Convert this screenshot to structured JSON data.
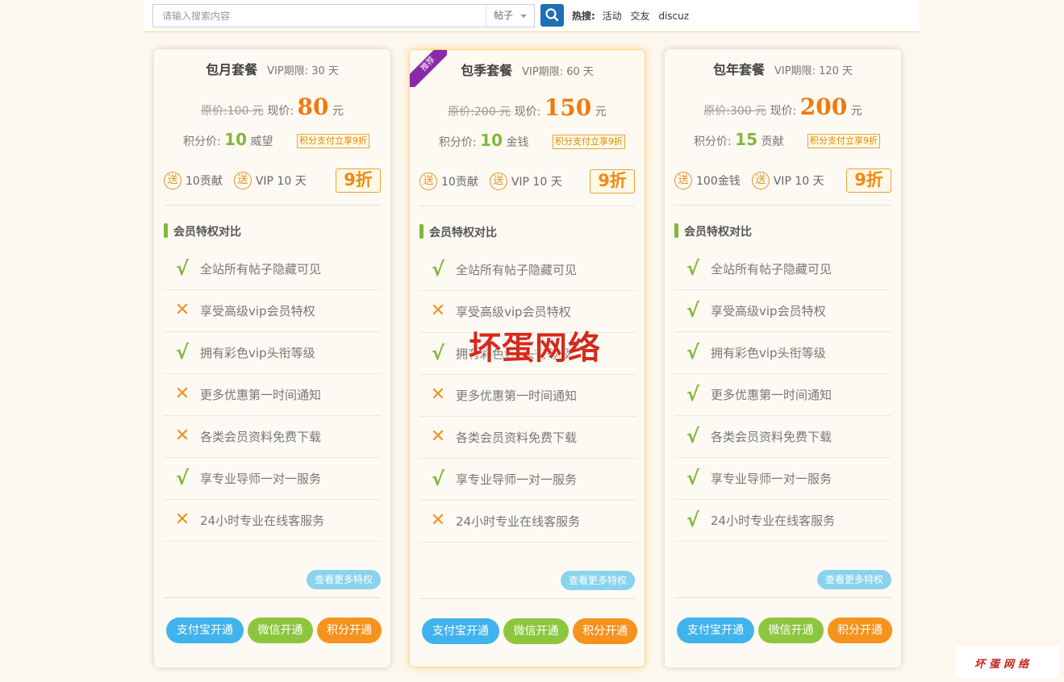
{
  "search": {
    "placeholder": "请输入搜索内容",
    "type": "帖子"
  },
  "hot": {
    "label": "热搜:",
    "items": [
      "活动",
      "交友",
      "discuz"
    ]
  },
  "labels": {
    "orig_prefix": "原价:",
    "now_prefix": "现价:",
    "yuan": "元",
    "credit_prefix": "积分价:",
    "credit_tag": "积分支付立享9折",
    "gift": "送",
    "compare": "会员特权对比",
    "more": "查看更多特权",
    "pay_alipay": "支付宝开通",
    "pay_wechat": "微信开通",
    "pay_credit": "积分开通",
    "ribbon": "推荐"
  },
  "features": [
    "全站所有帖子隐藏可见",
    "享受高级vip会员特权",
    "拥有彩色vip头衔等级",
    "更多优惠第一时间通知",
    "各类会员资料免费下载",
    "享专业导师一对一服务",
    "24小时专业在线客服务"
  ],
  "plans": [
    {
      "name": "包月套餐",
      "period": "VIP期限: 30 天",
      "orig": "100 元",
      "now": "80",
      "credit_value": "10",
      "credit_unit": "威望",
      "gift1": "10贡献",
      "gift2": "VIP 10 天",
      "discount": "9折",
      "checks": [
        true,
        false,
        true,
        false,
        false,
        true,
        false
      ]
    },
    {
      "name": "包季套餐",
      "period": "VIP期限: 60 天",
      "orig": "200 元",
      "now": "150",
      "credit_value": "10",
      "credit_unit": "金钱",
      "gift1": "10贡献",
      "gift2": "VIP 10 天",
      "discount": "9折",
      "checks": [
        true,
        false,
        true,
        false,
        false,
        true,
        false
      ]
    },
    {
      "name": "包年套餐",
      "period": "VIP期限: 120 天",
      "orig": "300 元",
      "now": "200",
      "credit_value": "15",
      "credit_unit": "贡献",
      "gift1": "100金钱",
      "gift2": "VIP 10 天",
      "discount": "9折",
      "checks": [
        true,
        true,
        true,
        true,
        true,
        true,
        true
      ]
    }
  ],
  "watermark": "坏蛋网络",
  "logo": "坏蛋网络",
  "colors": {
    "check": "#7fb83a",
    "cross": "#f0912a",
    "price": "#f07a10",
    "alipay": "#41b3ec",
    "wechat": "#8cc63f",
    "credit": "#f6931e"
  }
}
